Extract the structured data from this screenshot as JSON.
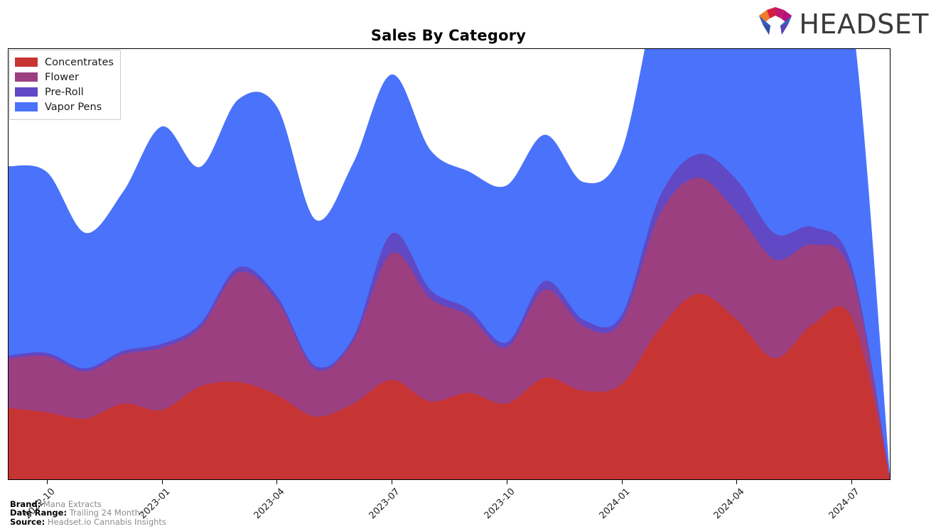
{
  "header": {
    "title": "Sales By Category",
    "logo_text": "HEADSET",
    "logo_icon": "headset-hexagon-logo"
  },
  "legend": {
    "position": "top-left",
    "items": [
      {
        "label": "Concentrates",
        "color": "#c73434"
      },
      {
        "label": "Flower",
        "color": "#9c3f80"
      },
      {
        "label": "Pre-Roll",
        "color": "#6148c4"
      },
      {
        "label": "Vapor Pens",
        "color": "#4a72fb"
      }
    ]
  },
  "footer": {
    "brand_key": "Brand:",
    "brand_value": "Mana Extracts",
    "date_range_key": "Date Range:",
    "date_range_value": "Trailing 24 Months",
    "source_key": "Source:",
    "source_value": "Headset.io Cannabis Insights"
  },
  "chart_data": {
    "type": "area",
    "stacked": true,
    "interpolation": "smooth-spline",
    "title": "Sales By Category",
    "xlabel": "",
    "ylabel": "",
    "grid": false,
    "axis_labels_rotated": -45,
    "x_tick_labels": [
      "2022-10",
      "2023-01",
      "2023-04",
      "2023-07",
      "2023-10",
      "2024-01",
      "2024-04",
      "2024-07"
    ],
    "x_tick_indices": [
      1,
      4,
      7,
      10,
      13,
      16,
      19,
      22
    ],
    "x": [
      "2022-09",
      "2022-10",
      "2022-11",
      "2022-12",
      "2023-01",
      "2023-02",
      "2023-03",
      "2023-04",
      "2023-05",
      "2023-06",
      "2023-07",
      "2023-08",
      "2023-09",
      "2023-10",
      "2023-11",
      "2023-12",
      "2024-01",
      "2024-02",
      "2024-03",
      "2024-04",
      "2024-05",
      "2024-06",
      "2024-07",
      "2024-08"
    ],
    "ylim": [
      0,
      100
    ],
    "series": [
      {
        "name": "Concentrates",
        "color": "#c73434",
        "values": [
          16.5,
          15.5,
          14.0,
          17.5,
          16.0,
          21.5,
          22.5,
          19.5,
          14.5,
          17.5,
          23.0,
          18.0,
          20.0,
          17.5,
          23.5,
          20.5,
          22.0,
          35.0,
          43.0,
          37.0,
          28.0,
          36.0,
          37.5,
          0.0
        ]
      },
      {
        "name": "Flower",
        "color": "#9c3f80",
        "values": [
          11.5,
          13.0,
          11.0,
          11.5,
          14.5,
          13.5,
          25.5,
          22.0,
          11.0,
          14.5,
          29.5,
          24.0,
          18.0,
          13.0,
          20.5,
          15.0,
          14.5,
          26.5,
          27.0,
          25.0,
          23.0,
          18.5,
          10.0,
          0.0
        ]
      },
      {
        "name": "Pre-Roll",
        "color": "#6148c4",
        "values": [
          0.7,
          0.8,
          0.7,
          0.8,
          0.9,
          1.0,
          1.2,
          1.0,
          0.8,
          0.9,
          4.5,
          2.0,
          1.5,
          1.2,
          2.0,
          1.5,
          1.5,
          4.0,
          5.5,
          7.5,
          6.0,
          4.0,
          2.0,
          0.0
        ]
      },
      {
        "name": "Vapor Pens",
        "color": "#4a72fb",
        "values": [
          44.0,
          42.0,
          31.5,
          37.0,
          50.5,
          36.5,
          39.0,
          44.0,
          34.0,
          40.5,
          37.0,
          32.5,
          32.0,
          36.5,
          34.0,
          32.0,
          38.0,
          50.0,
          62.0,
          50.0,
          56.0,
          62.0,
          58.0,
          0.0
        ]
      }
    ]
  }
}
